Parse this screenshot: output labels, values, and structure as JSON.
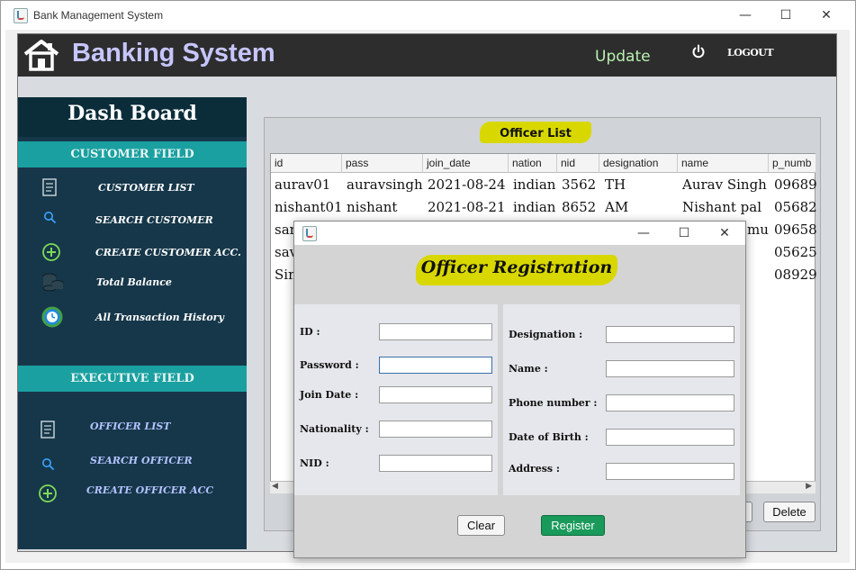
{
  "window": {
    "title": "Bank Management System"
  },
  "header": {
    "app_title": "Banking System",
    "update_label": "Update",
    "logout_label": "LOGOUT"
  },
  "sidebar": {
    "dash_title": "Dash Board",
    "customer_field_label": "CUSTOMER FIELD",
    "customer_items": [
      {
        "label": "CUSTOMER LIST",
        "icon": "document-icon"
      },
      {
        "label": "SEARCH CUSTOMER",
        "icon": "search-icon"
      },
      {
        "label": "CREATE CUSTOMER ACC.",
        "icon": "plus-circle-icon"
      },
      {
        "label": "Total Balance",
        "icon": "coins-icon"
      },
      {
        "label": "All Transaction History",
        "icon": "clock-icon"
      }
    ],
    "executive_field_label": "EXECUTIVE FIELD",
    "executive_items": [
      {
        "label": "OFFICER LIST",
        "icon": "document-icon"
      },
      {
        "label": "SEARCH OFFICER",
        "icon": "search-icon"
      },
      {
        "label": "CREATE OFFICER ACC",
        "icon": "plus-circle-icon"
      }
    ]
  },
  "officer_list": {
    "title": "Officer List",
    "columns": [
      "id",
      "pass",
      "join_date",
      "nation",
      "nid",
      "designation",
      "name",
      "p_numb"
    ],
    "rows": [
      [
        "aurav01",
        "auravsingh",
        "2021-08-24",
        "indian",
        "3562",
        "TH",
        "Aurav Singh",
        "09689"
      ],
      [
        "nishant01",
        "nishant",
        "2021-08-21",
        "indian",
        "8652",
        "AM",
        "Nishant pal",
        "05682"
      ],
      [
        "sar",
        "",
        "",
        "",
        "",
        "",
        "mu",
        "09658"
      ],
      [
        "sav",
        "",
        "",
        "",
        "",
        "",
        "",
        "05625"
      ],
      [
        "Sin",
        "",
        "",
        "",
        "",
        "",
        "",
        "08929"
      ]
    ],
    "delete_label": "Delete"
  },
  "dialog": {
    "title": "Officer Registration",
    "left_fields": [
      {
        "label": "ID :",
        "value": ""
      },
      {
        "label": "Password :",
        "value": ""
      },
      {
        "label": "Join Date :",
        "value": ""
      },
      {
        "label": "Nationality :",
        "value": ""
      },
      {
        "label": "NID :",
        "value": ""
      }
    ],
    "right_fields": [
      {
        "label": "Designation :",
        "value": ""
      },
      {
        "label": "Name :",
        "value": ""
      },
      {
        "label": "Phone number :",
        "value": ""
      },
      {
        "label": "Date of Birth :",
        "value": ""
      },
      {
        "label": "Address :",
        "value": ""
      }
    ],
    "clear_label": "Clear",
    "register_label": "Register"
  },
  "colors": {
    "header_bg": "#2d2d2d",
    "sidebar_bg": "#16374a",
    "accent_teal": "#1aa0a0",
    "highlight_yellow": "#d8d800",
    "register_green": "#1a9a5a"
  }
}
